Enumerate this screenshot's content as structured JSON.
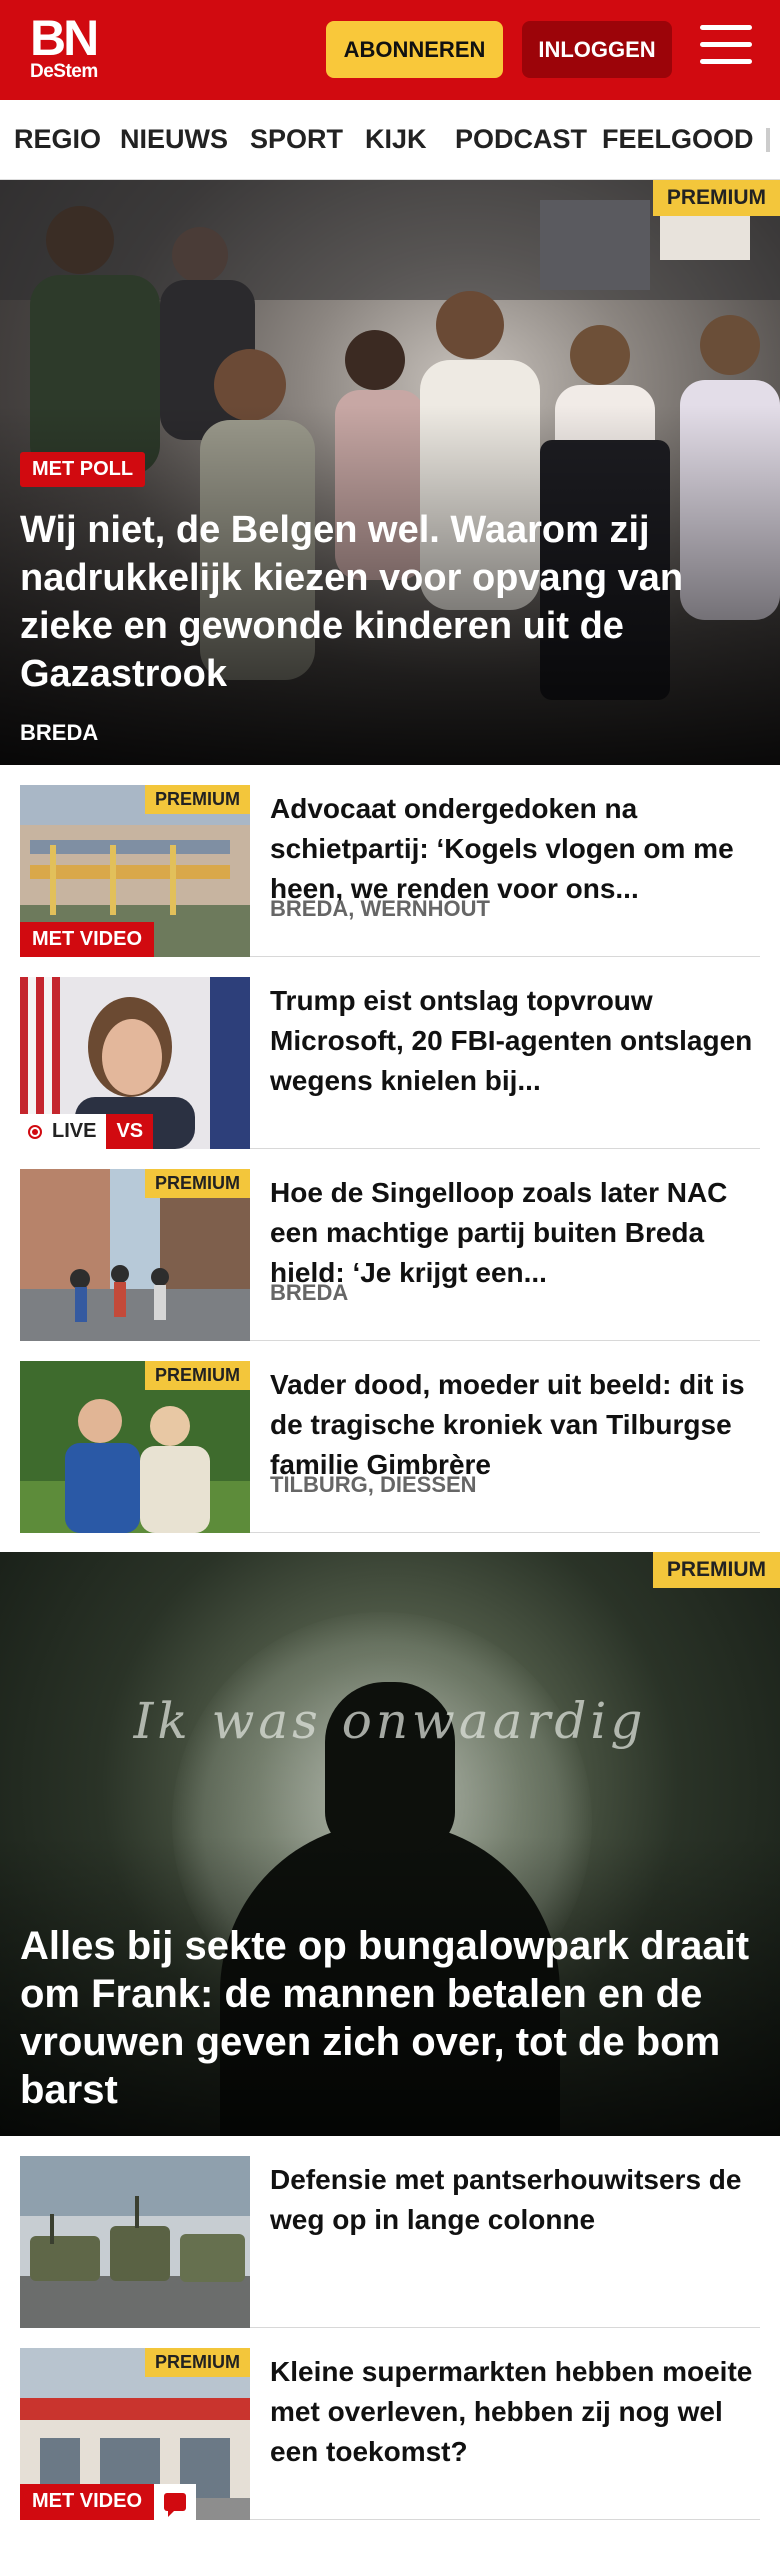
{
  "header": {
    "logo_main": "BN",
    "logo_sub": "DeStem",
    "subscribe_label": "ABONNEREN",
    "login_label": "INLOGGEN"
  },
  "nav": {
    "items": [
      "REGIO",
      "NIEUWS",
      "SPORT",
      "KIJK",
      "PODCAST",
      "FEELGOOD"
    ]
  },
  "hero": {
    "premium": "PREMIUM",
    "badge": "MET POLL",
    "title": "Wij niet, de Belgen wel. Waarom zij nadrukkelijk kiezen voor opvang van zieke en gewonde kinderen uit de Gazastrook",
    "location": "BREDA"
  },
  "articles": [
    {
      "premium": "PREMIUM",
      "video": "MET VIDEO",
      "title": "Advocaat ondergedoken na schietpartij: ‘Kogels vlogen om me heen, we renden voor ons...",
      "location": "BREDA, WERNHOUT"
    },
    {
      "live": "LIVE",
      "vs": "VS",
      "title": "Trump eist ontslag topvrouw Microsoft, 20 FBI-agenten ontslagen wegens knielen bij...",
      "location": ""
    },
    {
      "premium": "PREMIUM",
      "title": "Hoe de Singelloop zoals later NAC een machtige partij buiten Breda hield: ‘Je krijgt een...",
      "location": "BREDA"
    },
    {
      "premium": "PREMIUM",
      "title": "Vader dood, moeder uit beeld: dit is de tragische kroniek van Tilburgse familie Gimbrère",
      "location": "TILBURG, DIESSEN"
    }
  ],
  "feature": {
    "premium": "PREMIUM",
    "overlay_text": "Ik was onwaardig",
    "title": "Alles bij sekte op bungalowpark draait om Frank: de mannen betalen en de vrouwen geven zich over, tot de bom barst"
  },
  "articles2": [
    {
      "title": "Defensie met pantserhouwitsers de weg op in lange colonne"
    },
    {
      "premium": "PREMIUM",
      "video": "MET VIDEO",
      "title": "Kleine supermarkten hebben moeite met overleven, hebben zij nog wel een toekomst?"
    }
  ],
  "colors": {
    "brand_red": "#d10a10",
    "premium_yellow": "#f3c63b",
    "login_dark_red": "#9c0409"
  }
}
